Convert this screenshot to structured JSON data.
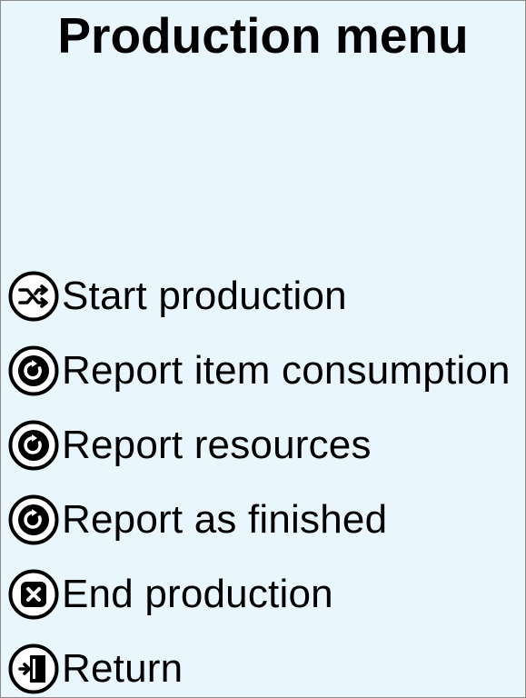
{
  "header": {
    "title": "Production menu"
  },
  "menu": {
    "items": [
      {
        "label": "Start production",
        "icon": "shuffle-icon"
      },
      {
        "label": "Report item consumption",
        "icon": "refresh-icon"
      },
      {
        "label": "Report resources",
        "icon": "refresh-icon"
      },
      {
        "label": "Report as finished",
        "icon": "refresh-icon"
      },
      {
        "label": "End production",
        "icon": "stop-x-icon"
      },
      {
        "label": "Return",
        "icon": "exit-door-icon"
      }
    ]
  },
  "colors": {
    "background": "#eaf6fe",
    "text": "#000000",
    "border": "#8c8c8c"
  }
}
